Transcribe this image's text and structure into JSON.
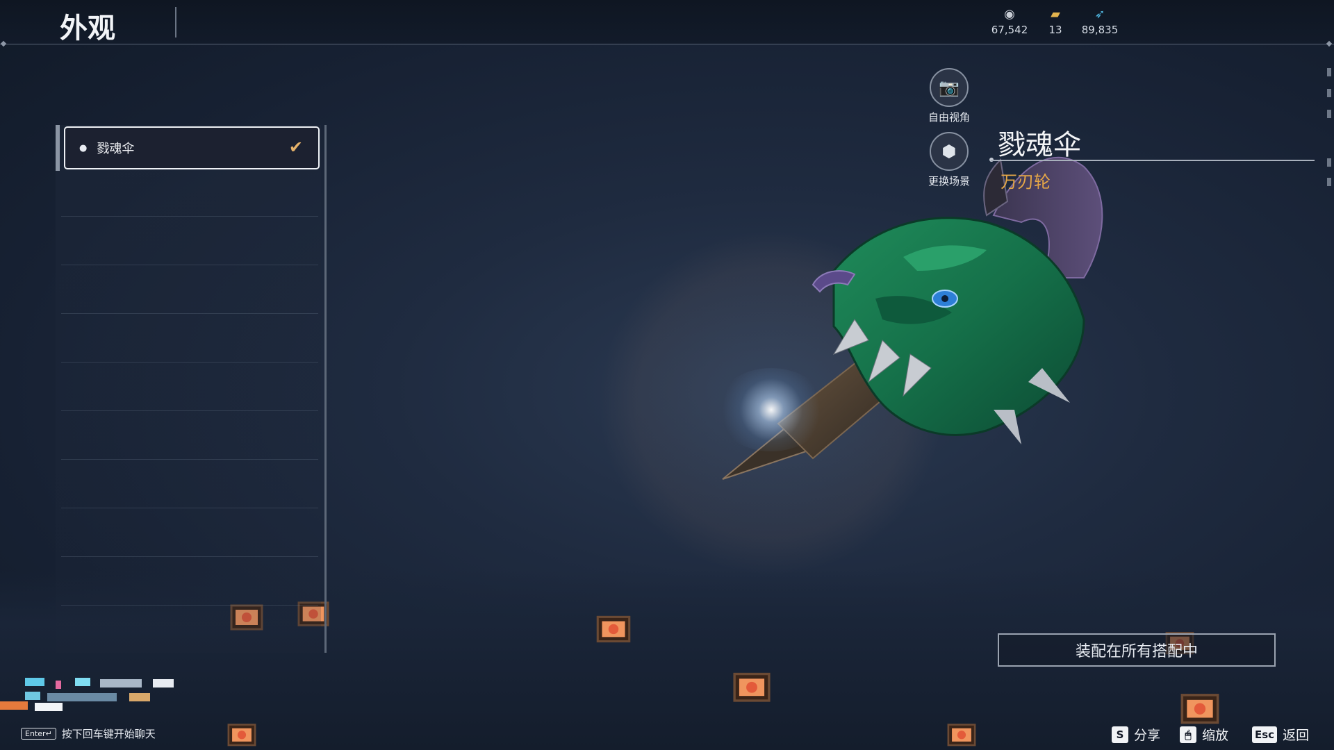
{
  "header": {
    "title": "外观"
  },
  "currencies": [
    {
      "icon": "silver-coins-icon",
      "value": "67,542",
      "color": "#c9ced6"
    },
    {
      "icon": "gold-ticket-icon",
      "value": "13",
      "color": "#e2b34e"
    },
    {
      "icon": "feather-icon",
      "value": "89,835",
      "color": "#4fb6e0"
    }
  ],
  "skin_list": {
    "items": [
      {
        "label": "戮魂伞",
        "selected": true,
        "icon": "drop-icon",
        "check_icon": "check-icon"
      }
    ]
  },
  "actions": {
    "free_camera": {
      "label": "自由视角",
      "icon": "camera-icon"
    },
    "change_scene": {
      "label": "更换场景",
      "icon": "scene-cube-icon"
    }
  },
  "item": {
    "name": "戮魂伞",
    "type": "万刃轮"
  },
  "equip_button": {
    "label": "装配在所有搭配中"
  },
  "chat": {
    "enter_key": "Enter↵",
    "hint": "按下回车键开始聊天"
  },
  "bottom_hints": [
    {
      "key": "S",
      "label": "分享"
    },
    {
      "key": "🖱",
      "label": "缩放"
    },
    {
      "key": "Esc",
      "label": "返回"
    }
  ],
  "colors": {
    "accent_orange": "#e6a747",
    "check": "#e7b36a"
  }
}
